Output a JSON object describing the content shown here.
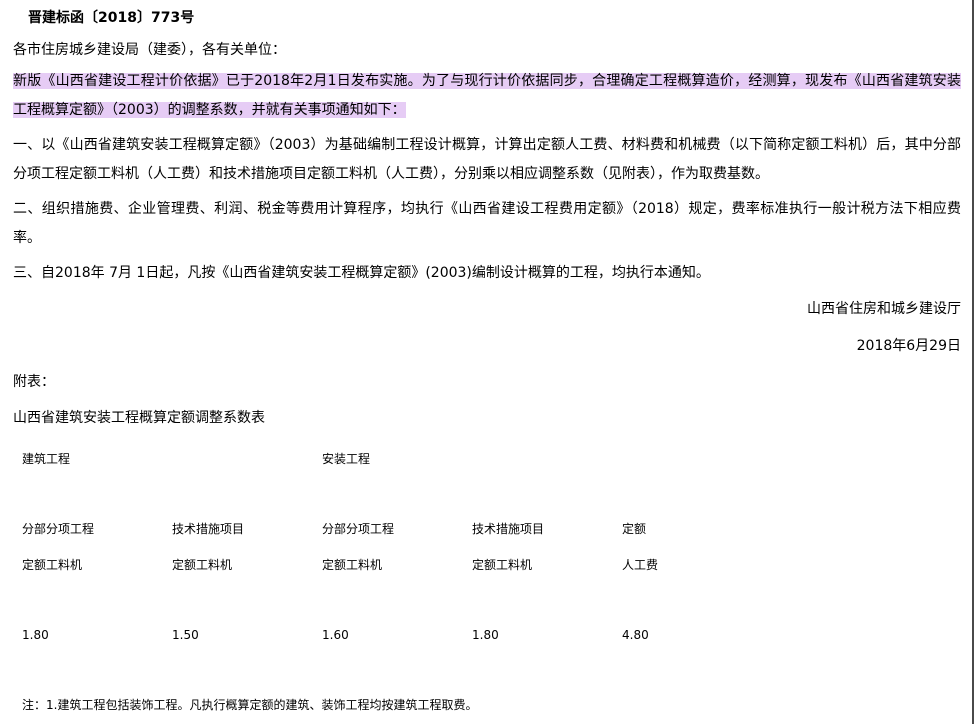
{
  "doc": {
    "title": "晋建标函〔2018〕773号",
    "salutation": "各市住房城乡建设局（建委），各有关单位：",
    "intro": "新版《山西省建设工程计价依据》已于2018年2月1日发布实施。为了与现行计价依据同步，合理确定工程概算造价，经测算，现发布《山西省建筑安装工程概算定额》（2003）的调整系数，并就有关事项通知如下：",
    "item1": "一、以《山西省建筑安装工程概算定额》（2003）为基础编制工程设计概算，计算出定额人工费、材料费和机械费（以下简称定额工料机）后，其中分部分项工程定额工料机（人工费）和技术措施项目定额工料机（人工费），分别乘以相应调整系数（见附表），作为取费基数。",
    "item2": "二、组织措施费、企业管理费、利润、税金等费用计算程序，均执行《山西省建设工程费用定额》（2018）规定，费率标准执行一般计税方法下相应费率。",
    "item3": "三、自2018年 7月 1日起，凡按《山西省建筑安装工程概算定额》(2003)编制设计概算的工程，均执行本通知。",
    "issuer": "山西省住房和城乡建设厅",
    "date": "2018年6月29日",
    "attachment_label": "附表：",
    "table_title": "山西省建筑安装工程概算定额调整系数表"
  },
  "table": {
    "group_headers": [
      "建筑工程",
      "安装工程"
    ],
    "col_headers_line1": [
      "分部分项工程",
      "技术措施项目",
      "分部分项工程",
      "技术措施项目",
      "定额"
    ],
    "col_headers_line2": [
      "定额工料机",
      "定额工料机",
      "定额工料机",
      "定额工料机",
      "人工费"
    ],
    "values": [
      "1.80",
      "1.50",
      "1.60",
      "1.80",
      "4.80"
    ]
  },
  "note": "注：1.建筑工程包括装饰工程。凡执行概算定额的建筑、装饰工程均按建筑工程取费。",
  "colors": {
    "highlight": "#e6ccf5",
    "frame": "#4a4a4a"
  }
}
